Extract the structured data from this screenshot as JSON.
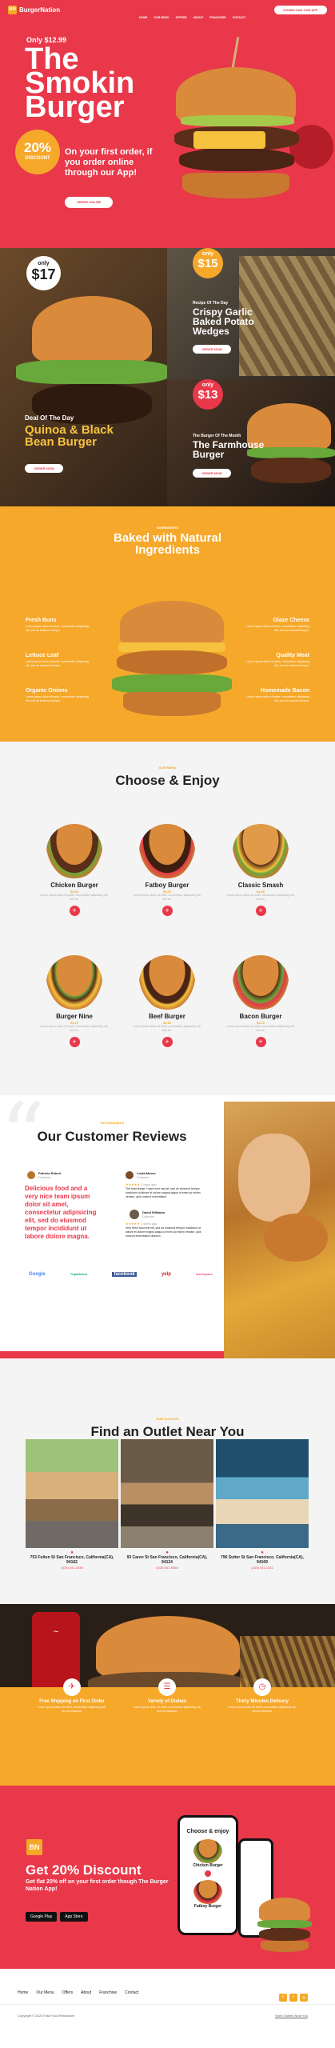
{
  "brand": {
    "logo": "BN",
    "name": "BurgerNation"
  },
  "nav": {
    "items": [
      "HOME",
      "OUR MENU",
      "OFFERS",
      "ABOUT",
      "FRANCHISE",
      "CONTACT"
    ],
    "cta": "DOWNLOAD OUR APP"
  },
  "hero": {
    "price": "Only $12.99",
    "title1": "The",
    "title2": "Smokin",
    "title3": "Burger",
    "discount_pct": "20%",
    "discount_word": "DISCOUNT",
    "offer": "On your first order, if you order online through our App!",
    "button": "ORDER ONLINE"
  },
  "promos": {
    "big": {
      "badge_only": "only",
      "badge_price": "$17",
      "kicker": "Deal Of The Day",
      "title": "Quinoa & Black Bean Burger",
      "button": "ORDER NOW"
    },
    "top": {
      "badge_only": "only",
      "badge_price": "$15",
      "kicker": "Recipe Of The Day",
      "title": "Crispy Garlic Baked Potato Wedges",
      "button": "ORDER NOW"
    },
    "bottom": {
      "badge_only": "only",
      "badge_price": "$13",
      "kicker": "The Burger Of The Month",
      "title": "The Farmhouse Burger",
      "button": "ORDER NOW"
    }
  },
  "ingredients": {
    "kicker": "INGREDIENTS",
    "title": "Baked with Natural Ingredients",
    "items": [
      {
        "name": "Fresh Buns",
        "desc": "Lorem ipsum dolor sit amet, consectetur adipiscing elit, sed do eiusmod tempor."
      },
      {
        "name": "Lettuce Leaf",
        "desc": "Lorem ipsum dolor sit amet, consectetur adipiscing elit, sed do eiusmod tempor."
      },
      {
        "name": "Organic Onions",
        "desc": "Lorem ipsum dolor sit amet, consectetur adipiscing elit, sed do eiusmod tempor."
      },
      {
        "name": "Glaze Cheese",
        "desc": "Lorem ipsum dolor sit amet, consectetur adipiscing elit, sed do eiusmod tempor."
      },
      {
        "name": "Quality Meat",
        "desc": "Lorem ipsum dolor sit amet, consectetur adipiscing elit, sed do eiusmod tempor."
      },
      {
        "name": "Homemade Bacon",
        "desc": "Lorem ipsum dolor sit amet, consectetur adipiscing elit, sed do eiusmod tempor."
      }
    ]
  },
  "menu": {
    "kicker": "OUR MENU",
    "title": "Choose & Enjoy",
    "items": [
      {
        "name": "Chicken Burger",
        "price": "$4.50",
        "desc": "Lorem ipsum dolor sit amet, consectetur adipiscing elit, sed do."
      },
      {
        "name": "Fatboy Burger",
        "price": "$3.20",
        "desc": "Lorem ipsum dolor sit amet, consectetur adipiscing elit, sed do."
      },
      {
        "name": "Classic Smash",
        "price": "$4.80",
        "desc": "Lorem ipsum dolor sit amet, consectetur adipiscing elit, sed do."
      },
      {
        "name": "Burger Nine",
        "price": "$5.10",
        "desc": "Lorem ipsum dolor sit amet, consectetur adipiscing elit, sed do."
      },
      {
        "name": "Beef Burger",
        "price": "$3.90",
        "desc": "Lorem ipsum dolor sit amet, consectetur adipiscing elit, sed do."
      },
      {
        "name": "Bacon Burger",
        "price": "$4.20",
        "desc": "Lorem ipsum dolor sit amet, consectetur adipiscing elit, sed do."
      }
    ],
    "add": "+"
  },
  "reviews": {
    "kicker": "TESTIMONIALS",
    "title": "Our Customer Reviews",
    "r1": {
      "name": "Patricia Robert",
      "role": "Customer",
      "quote": "Delicious food and a very nice team ipsum dolor sit amet, consectetur adipisicing elit, sed do eiusmod tempor incididunt ut labore dolore magna."
    },
    "r2": {
      "name": "Linda Moore",
      "role": "Customer",
      "when": "2 days ago",
      "text": "The best burger I have ever had sit, sed do eiusmod tempor incididunt ut labore et dolore magna aliqua ut enim ad minim veniam, quis nostrud exercitation."
    },
    "r3": {
      "name": "David Williams",
      "role": "Customer",
      "when": "1 week ago",
      "text": "Very fresh food enit elit, sed do eiusmod tempor incididunt ut labore et dolore magna aliqua ut enim ad minim veniam, quis nostrud exercitation ullamco."
    },
    "logos": [
      "Google",
      "Tripadvisor",
      "facebook",
      "yelp",
      "foursquare"
    ],
    "stars": "★★★★★"
  },
  "outlets": {
    "kicker": "OUR OUTLETS",
    "title": "Find an Outlet Near You",
    "items": [
      {
        "addr": "753 Fulton St San Francisco, California(CA), 94102",
        "phone": "(415) 241-1939"
      },
      {
        "addr": "93 Caren St San Francisco, California(CA), 94124",
        "phone": "(415) 601-9264"
      },
      {
        "addr": "796 Sutter St San Francisco, California(CA), 94109",
        "phone": "(415) 441-1101"
      }
    ]
  },
  "features": [
    {
      "title": "Free Shipping on First Order",
      "desc": "Lorem ipsum dolor sit amet, consectetur adipiscing elit, sed do eiusmod."
    },
    {
      "title": "Variety of Dishes",
      "desc": "Lorem ipsum dolor sit amet, consectetur adipiscing elit, sed do eiusmod."
    },
    {
      "title": "Thirty Minutes Delivery",
      "desc": "Lorem ipsum dolor sit amet, consectetur adipiscing elit, sed do eiusmod."
    }
  ],
  "app": {
    "title": "Get 20% Discount",
    "text": "Get flat 20% off on your first order though The Burger Nation App!",
    "google": "Google Play",
    "apple": "App Store",
    "phone_title": "Choose & enjoy",
    "phone_item": "Chicken Burger",
    "phone_item2": "Fatboy Burger"
  },
  "footer": {
    "links": [
      "Home",
      "Our Menu",
      "Offers",
      "About",
      "Franchise",
      "Contact"
    ],
    "copyright": "Copyright © 2024 Fast Food Restaurant",
    "store_link": "Store Outlets Near You"
  },
  "colors": {
    "red": "#e8384a",
    "orange": "#f6a82a"
  }
}
